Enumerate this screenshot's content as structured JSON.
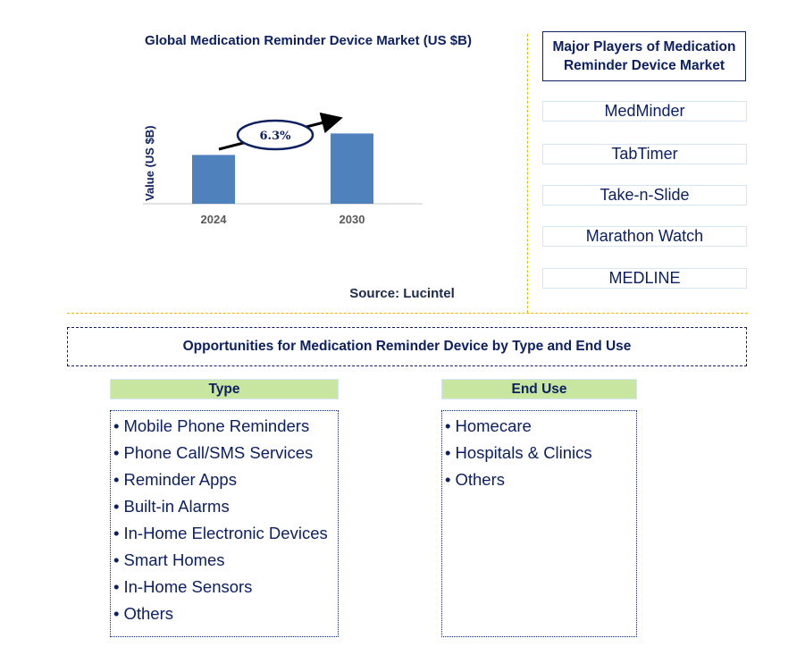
{
  "chart_data": {
    "type": "bar",
    "title": "Global Medication Reminder Device Market (US $B)",
    "categories": [
      "2024",
      "2030"
    ],
    "values": [
      1.0,
      1.44
    ],
    "xlabel": "",
    "ylabel": "Value (US $B)",
    "ylim": [
      0,
      1.5
    ],
    "grid": false,
    "annotations": [
      {
        "type": "cagr-arrow",
        "label": "6.3%",
        "from": "2024",
        "to": "2030"
      }
    ],
    "colors": {
      "bar": "#4f81bd",
      "axis": "#d9d9d9",
      "tick_text": "#595959",
      "ellipse_stroke": "#0d2061",
      "arrow": "#000000"
    }
  },
  "source": "Source: Lucintel",
  "players": {
    "title": "Major Players of Medication Reminder Device Market",
    "items": [
      "MedMinder",
      "TabTimer",
      "Take-n-Slide",
      "Marathon Watch",
      "MEDLINE"
    ]
  },
  "opportunities": {
    "title": "Opportunities for Medication Reminder Device by Type and End Use",
    "columns": [
      {
        "heading": "Type",
        "items": [
          "Mobile Phone Reminders",
          "Phone Call/SMS Services",
          "Reminder Apps",
          "Built-in Alarms",
          "In-Home Electronic Devices",
          "Smart Homes",
          "In-Home Sensors",
          "Others"
        ]
      },
      {
        "heading": "End Use",
        "items": [
          "Homecare",
          "Hospitals & Clinics",
          "Others"
        ]
      }
    ]
  },
  "bullet": "•",
  "colors": {
    "navy": "#0d2061",
    "divider": "#f5b400",
    "header_green": "#c8e6a0",
    "player_border": "#d4e6f4"
  }
}
